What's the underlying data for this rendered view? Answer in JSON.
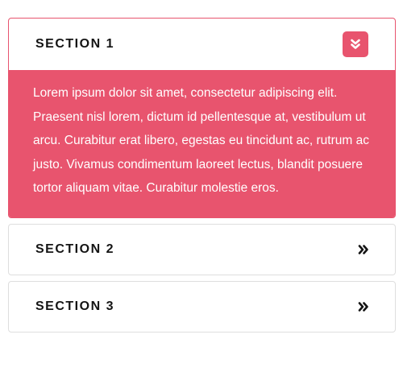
{
  "accordion": {
    "sections": [
      {
        "title": "SECTION 1",
        "expanded": true,
        "toggle_icon": "double-chevron-down-icon",
        "body": "Lorem ipsum dolor sit amet, consectetur adipiscing elit. Praesent nisl lorem, dictum id pellentesque at, vestibulum ut arcu. Curabitur erat libero, egestas eu tincidunt ac, rutrum ac justo. Vivamus condimentum laoreet lectus, blandit posuere tortor aliquam vitae. Curabitur molestie eros."
      },
      {
        "title": "SECTION 2",
        "expanded": false,
        "toggle_icon": "double-chevron-right-icon"
      },
      {
        "title": "SECTION 3",
        "expanded": false,
        "toggle_icon": "double-chevron-right-icon"
      }
    ]
  },
  "colors": {
    "accent": "#e8546e",
    "border": "#dedede",
    "title_text": "#141414",
    "body_text": "#ffffff"
  }
}
